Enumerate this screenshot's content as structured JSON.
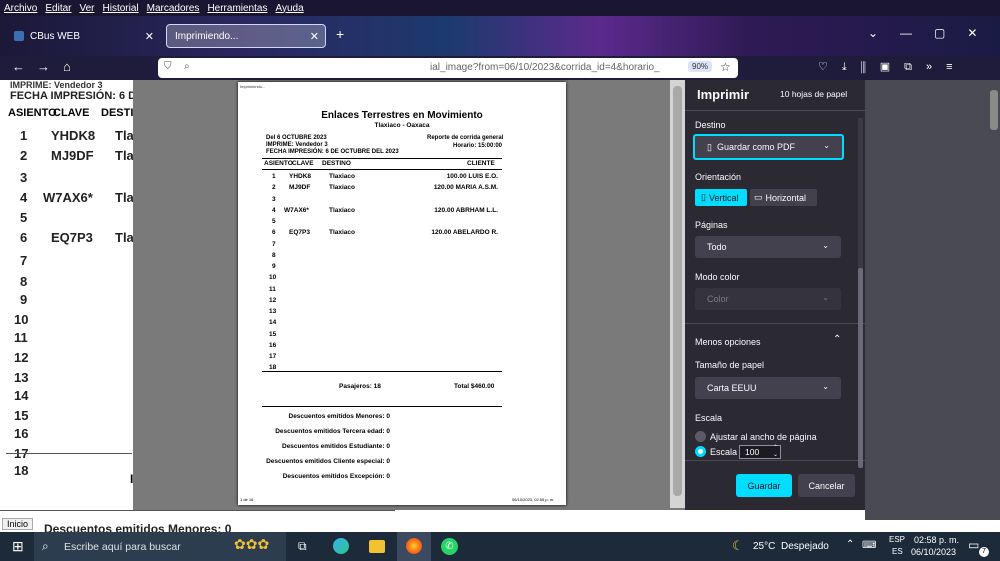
{
  "menu": [
    "Archivo",
    "Editar",
    "Ver",
    "Historial",
    "Marcadores",
    "Herramientas",
    "Ayuda"
  ],
  "tabs": [
    {
      "label": "CBus WEB"
    },
    {
      "label": "Imprimiendo..."
    }
  ],
  "url": {
    "text": "ial_image?from=06/10/2023&corrida_id=4&horario_",
    "zoom": "90%"
  },
  "background": {
    "header1": "IMPRIME: Vendedor 3",
    "header2": "FECHA IMPRESIÓN:  6 DE OCT",
    "cols": [
      "ASIENTO",
      "CLAVE",
      "DESTIN"
    ],
    "rows": [
      {
        "n": "1",
        "k": "YHDK8",
        "d": "Tlax"
      },
      {
        "n": "2",
        "k": "MJ9DF",
        "d": "Tlax"
      },
      {
        "n": "3",
        "k": "",
        "d": ""
      },
      {
        "n": "4",
        "k": "W7AX6*",
        "d": "Tlax"
      },
      {
        "n": "5",
        "k": "",
        "d": ""
      },
      {
        "n": "6",
        "k": "EQ7P3",
        "d": "Tlax"
      },
      {
        "n": "7",
        "k": "",
        "d": ""
      },
      {
        "n": "8",
        "k": "",
        "d": ""
      },
      {
        "n": "9",
        "k": "",
        "d": ""
      },
      {
        "n": "10",
        "k": "",
        "d": ""
      },
      {
        "n": "11",
        "k": "",
        "d": ""
      },
      {
        "n": "12",
        "k": "",
        "d": ""
      },
      {
        "n": "13",
        "k": "",
        "d": ""
      },
      {
        "n": "14",
        "k": "",
        "d": ""
      },
      {
        "n": "15",
        "k": "",
        "d": ""
      },
      {
        "n": "16",
        "k": "",
        "d": ""
      },
      {
        "n": "17",
        "k": "",
        "d": ""
      },
      {
        "n": "18",
        "k": "",
        "d": ""
      }
    ],
    "footer": "Descuentos emitidos Menores: 0",
    "partial": "I"
  },
  "paper": {
    "top_left": "Imprimiendo...",
    "title": "Enlaces Terrestres en Movimiento",
    "subtitle": "Tlaxiaco - Oaxaca",
    "del": "Del  6 OCTUBRE 2023",
    "reporte": "Reporte de corrida general",
    "imprime": "IMPRIME: Vendedor 3",
    "horario": "Horario: 15:00:00",
    "fecha": "FECHA IMPRESIÓN:  6 DE  OCTUBRE DEL 2023",
    "cols": [
      "ASIENTO",
      "CLAVE",
      "DESTINO",
      "CLIENTE"
    ],
    "rows": [
      {
        "n": "1",
        "k": "YHDK8",
        "d": "Tlaxiaco",
        "c": "100.00 LUIS E.O."
      },
      {
        "n": "2",
        "k": "MJ9DF",
        "d": "Tlaxiaco",
        "c": "120.00 MARIA A.S.M."
      },
      {
        "n": "3",
        "k": "",
        "d": "",
        "c": ""
      },
      {
        "n": "4",
        "k": "W7AX6*",
        "d": "Tlaxiaco",
        "c": "120.00 ABRHAM L.L."
      },
      {
        "n": "5",
        "k": "",
        "d": "",
        "c": ""
      },
      {
        "n": "6",
        "k": "EQ7P3",
        "d": "Tlaxiaco",
        "c": "120.00 ABELARDO R."
      },
      {
        "n": "7",
        "k": "",
        "d": "",
        "c": ""
      },
      {
        "n": "8",
        "k": "",
        "d": "",
        "c": ""
      },
      {
        "n": "9",
        "k": "",
        "d": "",
        "c": ""
      },
      {
        "n": "10",
        "k": "",
        "d": "",
        "c": ""
      },
      {
        "n": "11",
        "k": "",
        "d": "",
        "c": ""
      },
      {
        "n": "12",
        "k": "",
        "d": "",
        "c": ""
      },
      {
        "n": "13",
        "k": "",
        "d": "",
        "c": ""
      },
      {
        "n": "14",
        "k": "",
        "d": "",
        "c": ""
      },
      {
        "n": "15",
        "k": "",
        "d": "",
        "c": ""
      },
      {
        "n": "16",
        "k": "",
        "d": "",
        "c": ""
      },
      {
        "n": "17",
        "k": "",
        "d": "",
        "c": ""
      },
      {
        "n": "18",
        "k": "",
        "d": "",
        "c": ""
      }
    ],
    "pasajeros": "Pasajeros: 18",
    "total": "Total $460.00",
    "descuentos": [
      "Descuentos emitidos Menores: 0",
      "Descuentos emitidos Tercera edad: 0",
      "Descuentos emitidos Estudiante: 0",
      "Descuentos emitidos Cliente especial: 0",
      "Descuentos emitidos Excepción: 0"
    ],
    "page_num": "1 de 16",
    "page_date": "06/10/2023, 02:55 p. m."
  },
  "print": {
    "title": "Imprimir",
    "sheets": "10 hojas de papel",
    "destino_label": "Destino",
    "destino_value": "Guardar como PDF",
    "orientacion_label": "Orientación",
    "vertical": "Vertical",
    "horizontal": "Horizontal",
    "paginas_label": "Páginas",
    "paginas_value": "Todo",
    "color_label": "Modo color",
    "color_value": "Color",
    "menos": "Menos opciones",
    "tamano_label": "Tamaño de papel",
    "tamano_value": "Carta EEUU",
    "escala_label": "Escala",
    "ajustar": "Ajustar al ancho de página",
    "escala_opt": "Escala",
    "escala_value": "100",
    "guardar": "Guardar",
    "cancelar": "Cancelar"
  },
  "status": "Inicio",
  "taskbar": {
    "search": "Escribe aquí para buscar",
    "temp": "25°C",
    "weather": "Despejado",
    "lang1": "ESP",
    "lang2": "ES",
    "time": "02:58 p. m.",
    "date": "06/10/2023",
    "notif": "7"
  },
  "colors": {
    "accent": "#00ddff",
    "pane": "#2b2a33",
    "select": "#42414d"
  }
}
